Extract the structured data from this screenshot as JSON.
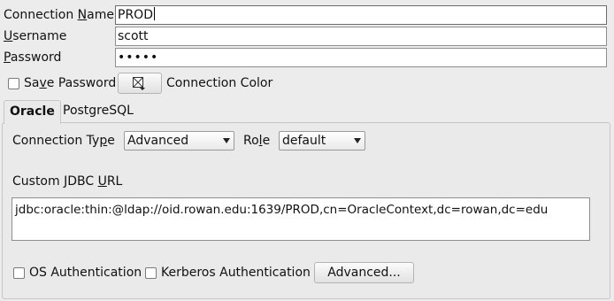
{
  "form": {
    "connection_name_label": "Connection Name",
    "connection_name_value": "PROD",
    "username_label": "Username",
    "username_value": "scott",
    "password_label": "Password",
    "password_value": "•••••",
    "save_password_label": "Save Password",
    "connection_color_label": "Connection Color"
  },
  "tabs": [
    {
      "label": "Oracle",
      "active": true
    },
    {
      "label": "PostgreSQL",
      "active": false
    }
  ],
  "oracle": {
    "connection_type_label": "Connection Type",
    "connection_type_value": "Advanced",
    "role_label": "Role",
    "role_value": "default",
    "jdbc_url_label": "Custom JDBC URL",
    "jdbc_url_value": "jdbc:oracle:thin:@ldap://oid.rowan.edu:1639/PROD,cn=OracleContext,dc=rowan,dc=edu",
    "os_auth_label": "OS Authentication",
    "kerberos_auth_label": "Kerberos Authentication",
    "advanced_button_label": "Advanced..."
  }
}
